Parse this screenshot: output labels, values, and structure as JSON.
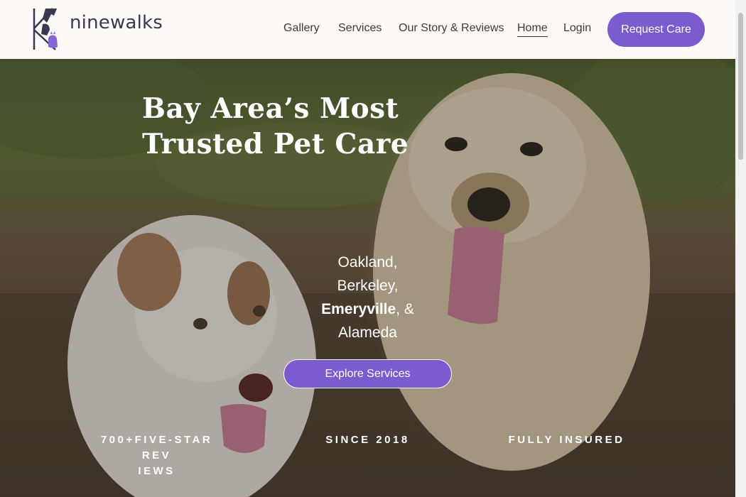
{
  "brand": {
    "name": "ninewalks",
    "accent_color": "#7b5ccf",
    "logo_icon": "dog-cat-logo-icon"
  },
  "nav": {
    "items": [
      {
        "label": "Gallery"
      },
      {
        "label": "Services"
      },
      {
        "label": "Our Story & Reviews"
      },
      {
        "label": "Home",
        "active": true
      },
      {
        "label": "Login"
      }
    ],
    "cta_label": "Request Care"
  },
  "hero": {
    "headline_line1": "Bay Area’s Most",
    "headline_line2": "Trusted Pet Care",
    "cities": {
      "line1": "Oakland,",
      "line2": "Berkeley,",
      "line3_bold": "Emeryville",
      "line3_rest": ", &",
      "line4": "Alameda"
    },
    "button_label": "Explore Services",
    "background_icon": "two-dogs-photo"
  },
  "stats": [
    {
      "line1": "700+FIVE-STAR REV",
      "line2": "IEWS"
    },
    {
      "line1": "SINCE 2018"
    },
    {
      "line1": "FULLY INSURED"
    }
  ]
}
